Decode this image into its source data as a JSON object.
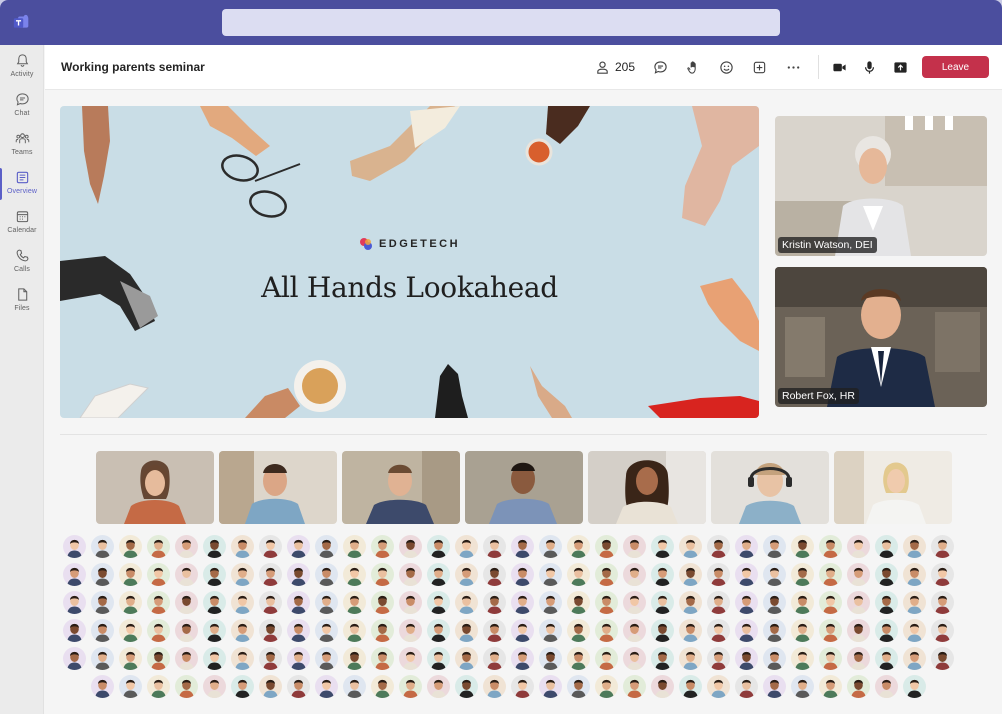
{
  "app": {
    "search_placeholder": ""
  },
  "rail": [
    {
      "id": "activity",
      "label": "Activity",
      "icon": "bell-icon"
    },
    {
      "id": "chat",
      "label": "Chat",
      "icon": "chat-icon"
    },
    {
      "id": "teams",
      "label": "Teams",
      "icon": "teams-icon"
    },
    {
      "id": "overview",
      "label": "Overview",
      "icon": "overview-icon",
      "active": true
    },
    {
      "id": "calendar",
      "label": "Calendar",
      "icon": "calendar-icon"
    },
    {
      "id": "calls",
      "label": "Calls",
      "icon": "phone-icon"
    },
    {
      "id": "files",
      "label": "Files",
      "icon": "file-icon"
    }
  ],
  "meeting": {
    "title": "Working parents seminar",
    "participant_count": "205",
    "leave_label": "Leave",
    "leave_color": "#c4314b"
  },
  "slide": {
    "brand": "EDGETECH",
    "title": "All Hands Lookahead",
    "background": "#c9dde6"
  },
  "speakers": [
    {
      "name": "Kristin Watson, DEI"
    },
    {
      "name": "Robert Fox, HR"
    }
  ],
  "accent": "#5b5fc7",
  "titlebar_color": "#4b4e9e"
}
